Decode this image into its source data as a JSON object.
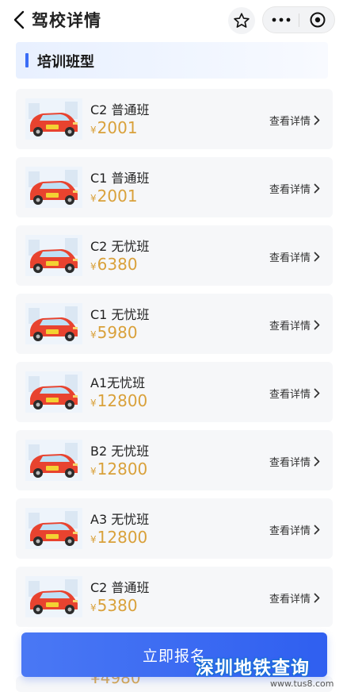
{
  "header": {
    "title": "驾校详情",
    "icons": [
      "chevron-left-icon",
      "star-icon",
      "more-icon",
      "target-icon"
    ]
  },
  "section": {
    "title": "培训班型"
  },
  "detail_label": "查看详情",
  "courses": [
    {
      "name": "C2 普通班",
      "currency": "¥",
      "price": "2001"
    },
    {
      "name": "C1 普通班",
      "currency": "¥",
      "price": "2001"
    },
    {
      "name": "C2 无忧班",
      "currency": "¥",
      "price": "6380"
    },
    {
      "name": "C1 无忧班",
      "currency": "¥",
      "price": "5980"
    },
    {
      "name": "A1无忧班",
      "currency": "¥",
      "price": "12800"
    },
    {
      "name": "B2 无忧班",
      "currency": "¥",
      "price": "12800"
    },
    {
      "name": "A3 无忧班",
      "currency": "¥",
      "price": "12800"
    },
    {
      "name": "C2 普通班",
      "currency": "¥",
      "price": "5380"
    }
  ],
  "partial_price": "¥4980",
  "cta": {
    "label": "立即报名"
  },
  "watermark": {
    "text": "深圳地铁查询",
    "url": "www.tus8.com"
  },
  "colors": {
    "accent": "#3a6cf6",
    "price": "#d9a13b",
    "card_bg": "#f6f7f9",
    "car": "#e8432f"
  }
}
